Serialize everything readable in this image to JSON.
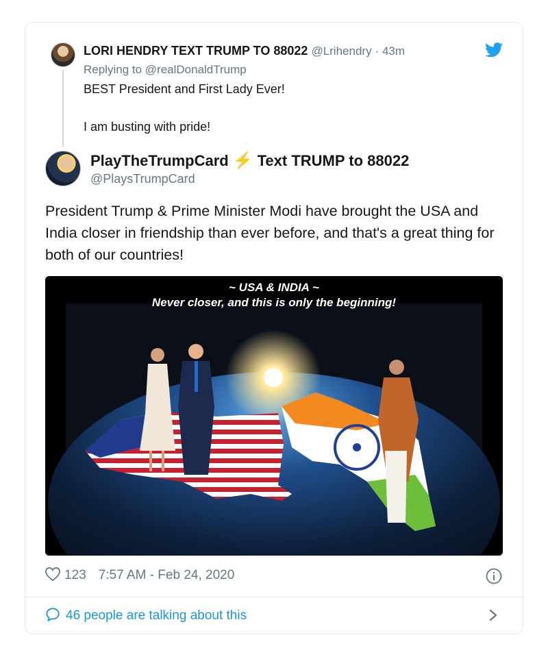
{
  "reply": {
    "name": "LORI HENDRY TEXT TRUMP TO 88022",
    "handle": "@Lrihendry",
    "time": "· 43m",
    "replying_to": "Replying to @realDonaldTrump",
    "text_line1": "BEST President and First Lady Ever!",
    "text_line2": "I am busting with pride!"
  },
  "tweet": {
    "name_part1": "PlayTheTrumpCard",
    "name_part2": "Text TRUMP to 88022",
    "handle": "@PlaysTrumpCard",
    "text": "President Trump & Prime Minister Modi have brought the USA and India closer in friendship than ever before, and that's a great thing for both of our countries!"
  },
  "media": {
    "caption_line1": "~ USA & INDIA ~",
    "caption_line2": "Never closer, and this is only the beginning!"
  },
  "footer": {
    "likes": "123",
    "timestamp": "7:57 AM - Feb 24, 2020",
    "talking": "46 people are talking about this"
  },
  "icons": {
    "brand": "twitter-bird-icon",
    "like": "heart-icon",
    "info": "info-icon",
    "comment": "speech-bubble-icon",
    "more": "chevron-right-icon"
  },
  "colors": {
    "twitter_blue": "#1b95e0",
    "muted": "#657786",
    "text": "#14171a",
    "bolt": "#f4a21b"
  }
}
